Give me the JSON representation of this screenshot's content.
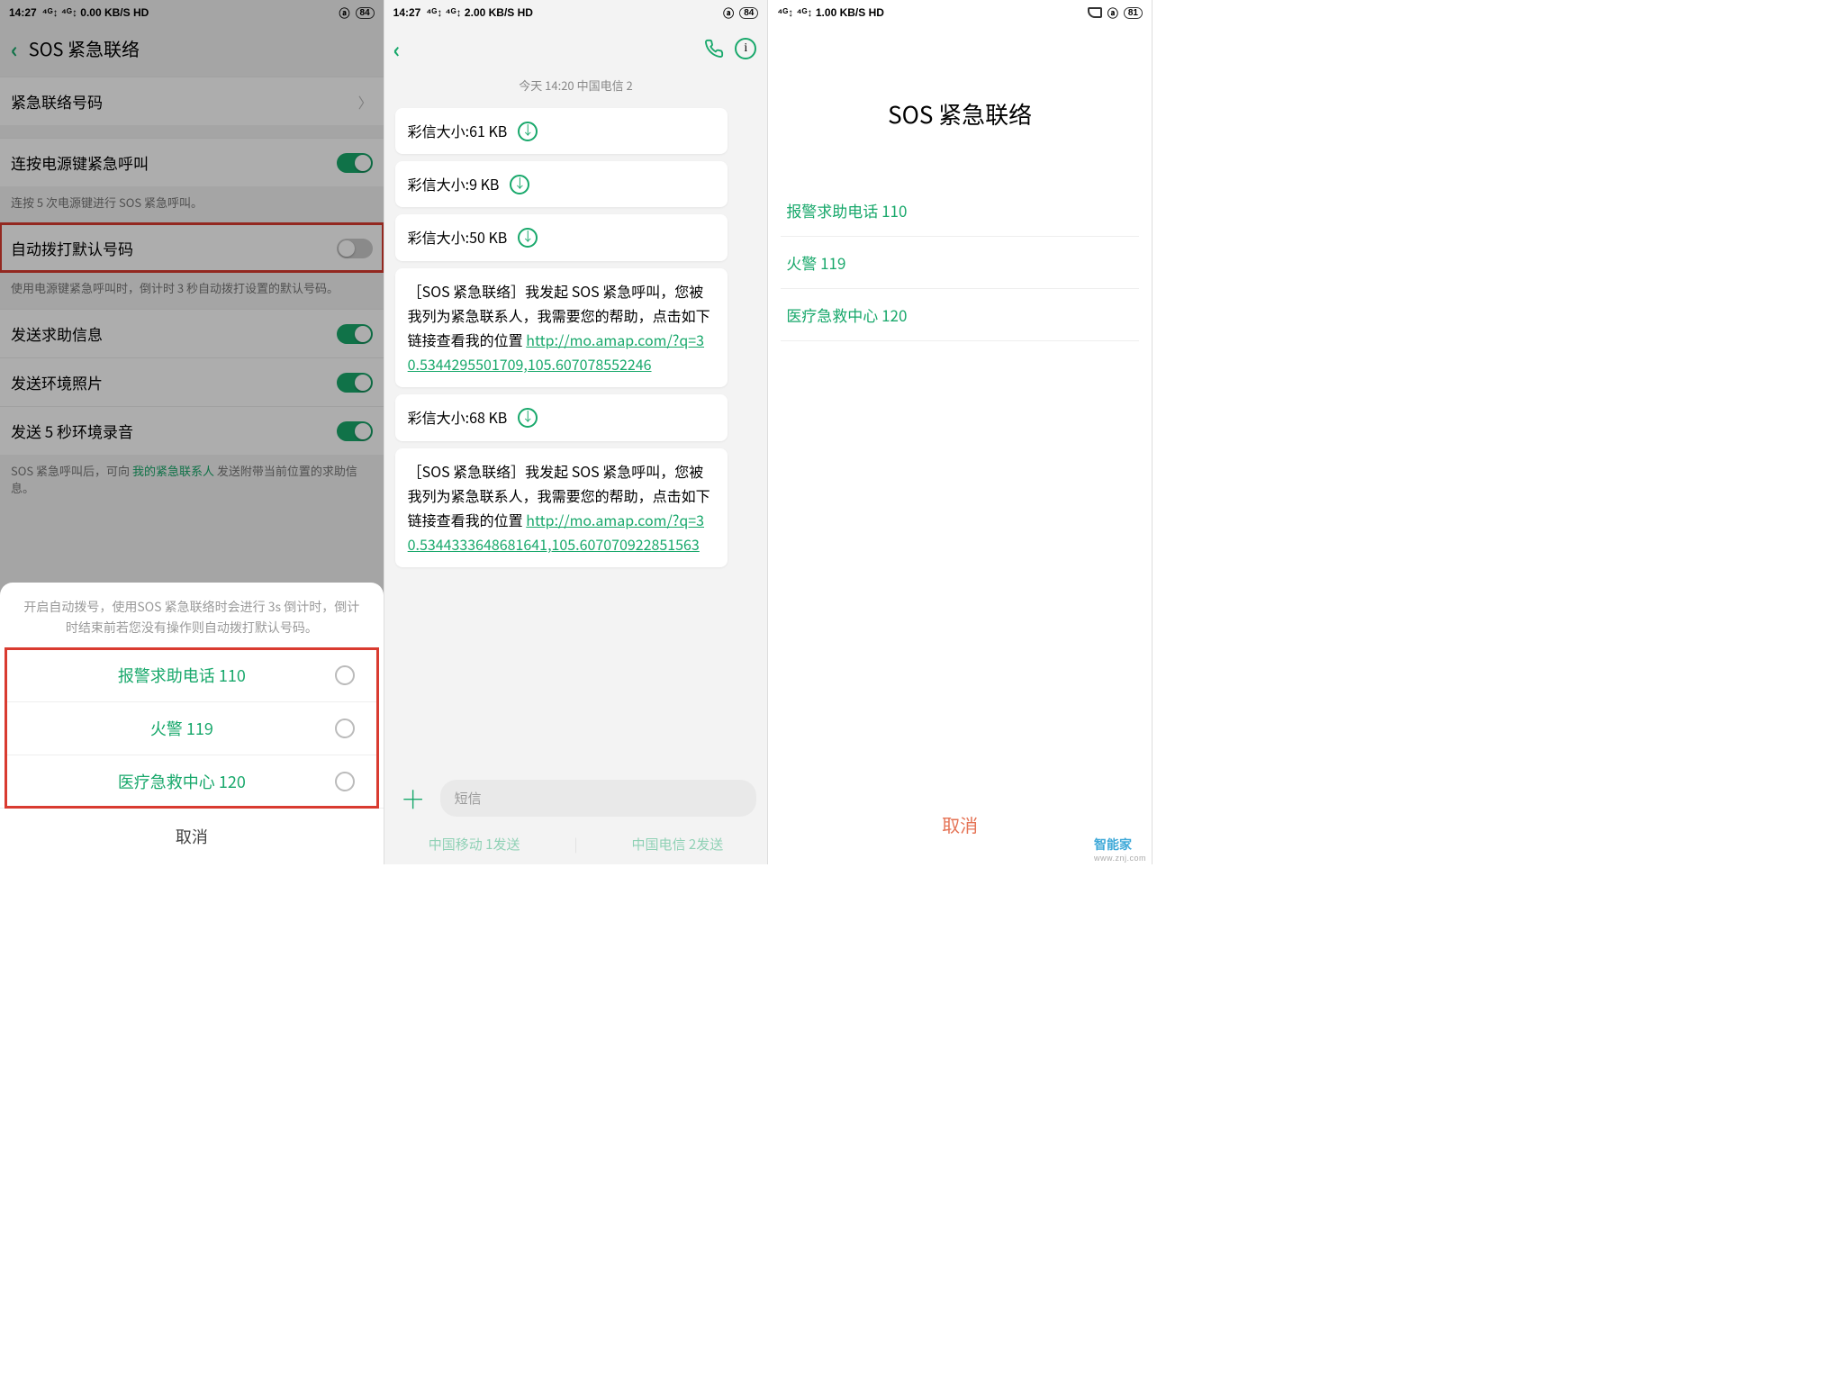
{
  "panel1": {
    "status": {
      "time": "14:27",
      "signal": "⁴ᴳ↕ ⁴ᴳ↕ 0.00 KB/S HD",
      "battery": "84"
    },
    "title": "SOS 紧急联络",
    "rows": {
      "contact_numbers": "紧急联络号码",
      "power_sos": "连按电源键紧急呼叫",
      "power_sos_sub": "连按 5 次电源键进行 SOS 紧急呼叫。",
      "auto_dial": "自动拨打默认号码",
      "auto_dial_sub": "使用电源键紧急呼叫时，倒计时 3 秒自动拨打设置的默认号码。",
      "send_help": "发送求助信息",
      "send_env_photo": "发送环境照片",
      "send_5s_audio": "发送 5 秒环境录音",
      "help_sub_pre": "SOS 紧急呼叫后，可向 ",
      "help_sub_link": "我的紧急联系人",
      "help_sub_post": " 发送附带当前位置的求助信息。"
    },
    "sheet": {
      "hint": "开启自动拨号，使用SOS 紧急联络时会进行 3s 倒计时，倒计时结束前若您没有操作则自动拨打默认号码。",
      "options": [
        "报警求助电话 110",
        "火警 119",
        "医疗急救中心 120"
      ],
      "cancel": "取消"
    }
  },
  "panel2": {
    "status": {
      "time": "14:27",
      "signal": "⁴ᴳ↕ ⁴ᴳ↕ 2.00 KB/S HD",
      "battery": "84"
    },
    "thread_meta": "今天 14:20   中国电信 2",
    "msgs": [
      {
        "type": "mms",
        "text": "彩信大小:61 KB"
      },
      {
        "type": "mms",
        "text": "彩信大小:9 KB"
      },
      {
        "type": "mms",
        "text": "彩信大小:50 KB"
      },
      {
        "type": "sos",
        "body": "［SOS 紧急联络］我发起 SOS 紧急呼叫，您被我列为紧急联系人，我需要您的帮助，点击如下链接查看我的位置 ",
        "link": "http://mo.amap.com/?q=30.5344295501709,105.607078552246"
      },
      {
        "type": "mms",
        "text": "彩信大小:68 KB"
      },
      {
        "type": "sos",
        "body": "［SOS 紧急联络］我发起 SOS 紧急呼叫，您被我列为紧急联系人，我需要您的帮助，点击如下链接查看我的位置 ",
        "link": "http://mo.amap.com/?q=30.5344333648681641,105.607070922851563"
      }
    ],
    "compose": {
      "placeholder": "短信"
    },
    "send_tabs": [
      "中国移动 1发送",
      "中国电信 2发送"
    ]
  },
  "panel3": {
    "status": {
      "signal": "⁴ᴳ↕ ⁴ᴳ↕ 1.00 KB/S HD",
      "battery": "81"
    },
    "title": "SOS 紧急联络",
    "items": [
      "报警求助电话 110",
      "火警 119",
      "医疗急救中心 120"
    ],
    "cancel": "取消",
    "watermark": "智能家",
    "watermark_url": "www.znj.com"
  }
}
